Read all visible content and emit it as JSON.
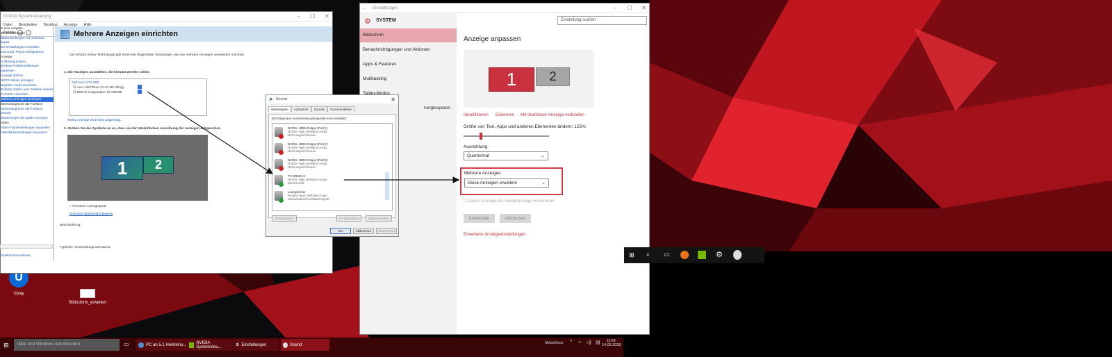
{
  "nvidia": {
    "title": "NVIDIA Systemsteuerung",
    "menu": [
      "Datei",
      "Bearbeiten",
      "Desktop",
      "Anzeige",
      "Hilfe"
    ],
    "back_label": "Zurück",
    "tree_head": "le eine Aufgabe...",
    "tree": [
      {
        "t": "3D-Einstellungen",
        "k": "blk"
      },
      {
        "t": "Bildeinstellungen mit Vorschau anpas",
        "k": ""
      },
      {
        "t": "3D-Einstellungen verwalten",
        "k": ""
      },
      {
        "t": "Surround, PhysX konfigurieren",
        "k": ""
      },
      {
        "t": "Anzeige",
        "k": "blk"
      },
      {
        "t": "Auflösung ändern",
        "k": ""
      },
      {
        "t": "Desktop-Farbeinstellungen anpassen",
        "k": ""
      },
      {
        "t": "Anzeige drehen",
        "k": ""
      },
      {
        "t": "HDCP-Status anzeigen",
        "k": ""
      },
      {
        "t": "Digitales Audio einrichten",
        "k": ""
      },
      {
        "t": "Desktop-Größe und -Position anpass",
        "k": ""
      },
      {
        "t": "G-SYNC einrichten",
        "k": ""
      },
      {
        "t": "Mehrere Anzeigen einrichten",
        "k": "sel"
      },
      {
        "t": "Stereoskopische 3D-Funktion",
        "k": "blk"
      },
      {
        "t": "Stereoskopische 3D-Funktion einricht",
        "k": ""
      },
      {
        "t": "Bewertungen für Spiele anzeigen",
        "k": ""
      },
      {
        "t": "Video",
        "k": "blk"
      },
      {
        "t": "Video-Farbeinstellungen anpassen",
        "k": ""
      },
      {
        "t": "Videobildeinstellungen anpassen",
        "k": ""
      }
    ],
    "tree_footer": "Systeminformationen",
    "page_title": "Mehrere Anzeigen einrichten",
    "intro": "Die NVIDIA nView Technologie gibt Ihnen die Möglichkeit, festzulegen, wie Sie mehrere Anzeigen verwenden möchten.",
    "step1": "1. Die Anzeigen auswählen, die benutzt werden sollen.",
    "gpu": "GeForce GTX 980",
    "displays": [
      "Acer XB270HU (G-SYNC-fähig)",
      "DMYO Corporation TX-NR535"
    ],
    "missing_link": "Meine Anzeige wird nicht angezeigt...",
    "step2": "2. Ordnen Sie die Symbole so an, dass sie der tatsächlichen Anordnung der Anzeigen entsprechen.",
    "primary_label": "Primäres Anzeigegerät",
    "surround_link": "Surround Spanning-Optionen",
    "desc_label": "Beschreibung:",
    "usage_label": "Typische Verwendungs-Szenarios:"
  },
  "sound": {
    "title": "Sound",
    "tabs": [
      "Wiedergabe",
      "Aufnahme",
      "Sounds",
      "Kommunikation"
    ],
    "intro": "Die folgenden Audiowiedergabegeräte sind installiert:",
    "devices": [
      {
        "name": "NVIDIA HDMI Output (Port 1)",
        "sub": "NVIDIA High Definition Audio",
        "state": "Nicht angeschlossen",
        "badge": "#cc2222"
      },
      {
        "name": "NVIDIA HDMI Output (Port 2)",
        "sub": "NVIDIA High Definition Audio",
        "state": "Nicht angeschlossen",
        "badge": "#cc2222"
      },
      {
        "name": "NVIDIA HDMI Output (Port 3)",
        "sub": "NVIDIA High Definition Audio",
        "state": "Nicht angeschlossen",
        "badge": "#cc2222"
      },
      {
        "name": "TX-NR535-C",
        "sub": "NVIDIA High Definition Audio",
        "state": "Bereitschaft",
        "badge": "#2a9a3a"
      },
      {
        "name": "Lautsprecher",
        "sub": "Realtek High Definition Audio",
        "state": "Standardkommunikationsgerät",
        "badge": "#2a9a3a"
      }
    ],
    "configure": "Konfigurieren",
    "set_default": "Als Standard ▾",
    "properties": "Eigenschaften",
    "ok": "OK",
    "cancel": "Abbrechen",
    "apply": "Übernehmen"
  },
  "settings": {
    "title": "Einstellungen",
    "header": "SYSTEM",
    "search_placeholder": "Einstellung suchen",
    "nav": [
      "Bildschirm",
      "Benachrichtigungen und Aktionen",
      "Apps & Features",
      "Multitasking",
      "Tablet-Modus",
      "Stromsparen und Energiesparen"
    ],
    "nav_partial": "nergiesparen",
    "page_title": "Anzeige anpassen",
    "monitor_1": "1",
    "monitor_2": "2",
    "links": [
      "Identifizieren",
      "Erkennen",
      "Mit drahtloser Anzeige verbinden"
    ],
    "size_label": "Größe von Text, Apps und anderen Elementen ändern: 125%",
    "size_fraction": 0.2,
    "orientation_label": "Ausrichtung",
    "orientation_value": "Querformat",
    "multi_label": "Mehrere Anzeigen",
    "multi_value": "Diese Anzeigen erweitern",
    "main_display_check": "Diese Anzeige als Hauptanzeige verwenden",
    "apply": "Anwenden",
    "cancel": "Abbrechen",
    "advanced_link": "Erweiterte Anzeigeeinstellungen"
  },
  "desktop": {
    "uplay": "Uplay",
    "screenshot": "Bildschirm_erweitert"
  },
  "taskbar": {
    "search": "Web und Windows durchsuchen",
    "items": [
      "PC an 5.1 Heimkino...",
      "NVIDIA Systemsteu...",
      "Einstellungen",
      "Sound"
    ],
    "tray_label": "MetaGlock",
    "time": "11:09",
    "date": "14.05.2016"
  },
  "colors": {
    "accent": "#c8323e",
    "nvidia_blue": "#2f6fd6",
    "highlight": "#d33a45"
  }
}
